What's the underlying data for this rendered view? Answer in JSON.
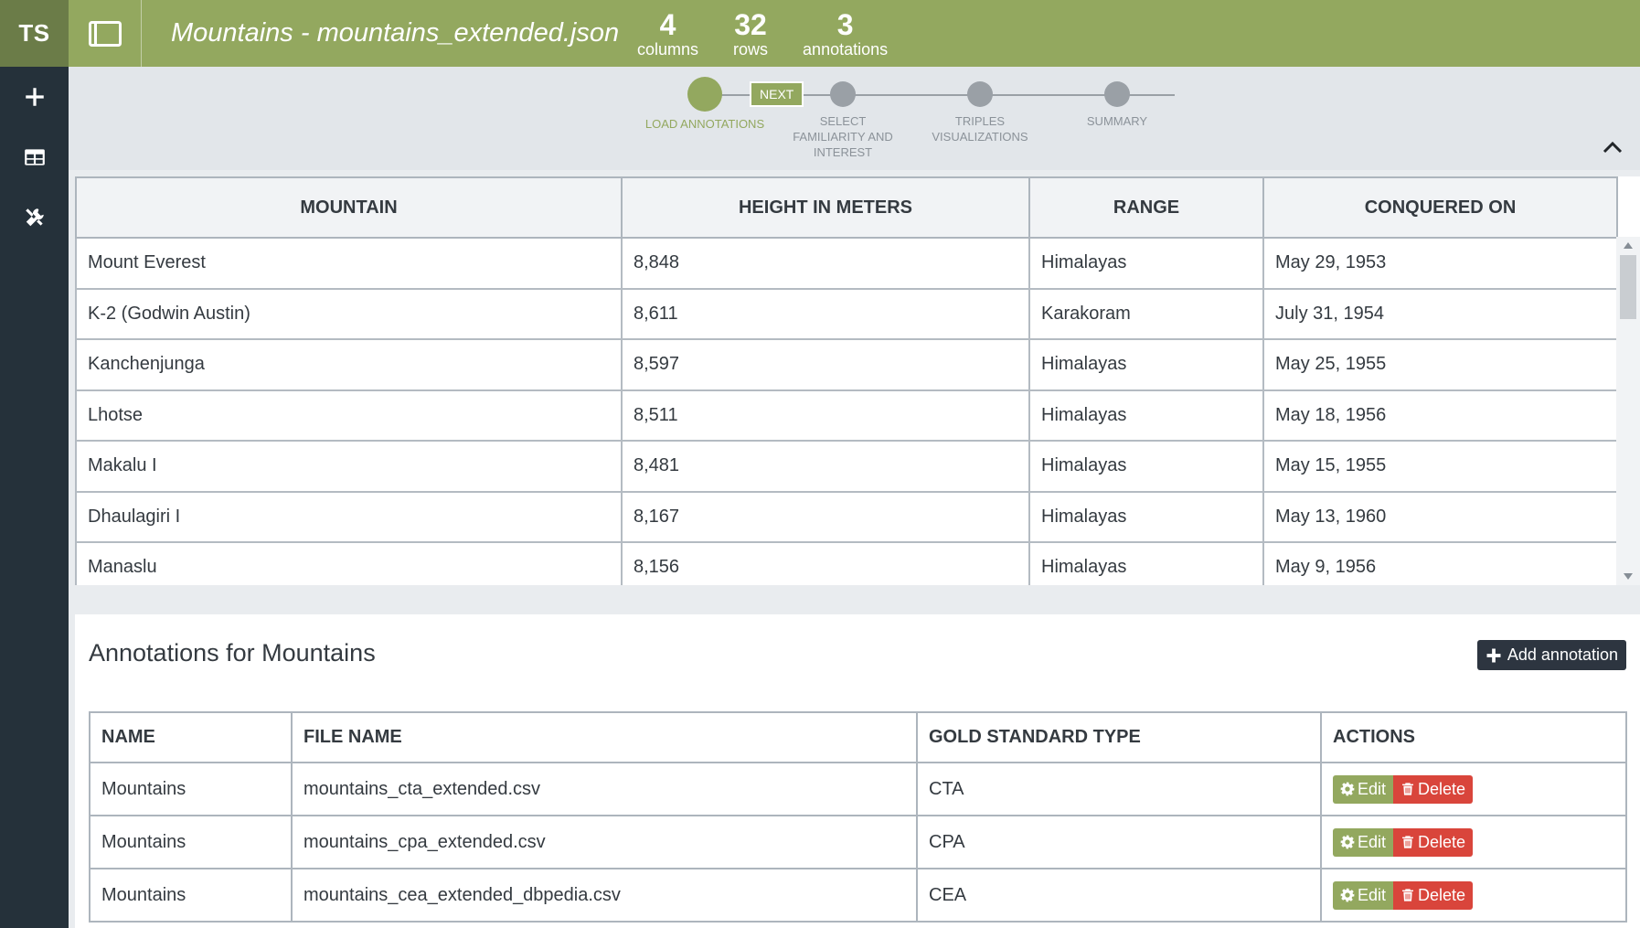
{
  "app": {
    "logo": "TS"
  },
  "header": {
    "title": "Mountains - mountains_extended.json",
    "stats": [
      {
        "value": "4",
        "label": "columns"
      },
      {
        "value": "32",
        "label": "rows"
      },
      {
        "value": "3",
        "label": "annotations"
      }
    ]
  },
  "stepper": {
    "next_label": "NEXT",
    "steps": [
      {
        "label": "LOAD ANNOTATIONS",
        "active": true
      },
      {
        "label": "SELECT FAMILIARITY AND INTEREST",
        "active": false
      },
      {
        "label": "TRIPLES VISUALIZATIONS",
        "active": false
      },
      {
        "label": "SUMMARY",
        "active": false
      }
    ]
  },
  "data_table": {
    "headers": [
      "MOUNTAIN",
      "HEIGHT IN METERS",
      "RANGE",
      "CONQUERED ON"
    ],
    "rows": [
      [
        "Mount Everest",
        "8,848",
        "Himalayas",
        "May 29, 1953"
      ],
      [
        "K-2 (Godwin Austin)",
        "8,611",
        "Karakoram",
        "July 31, 1954"
      ],
      [
        "Kanchenjunga",
        "8,597",
        "Himalayas",
        "May 25, 1955"
      ],
      [
        "Lhotse",
        "8,511",
        "Himalayas",
        "May 18, 1956"
      ],
      [
        "Makalu I",
        "8,481",
        "Himalayas",
        "May 15, 1955"
      ],
      [
        "Dhaulagiri I",
        "8,167",
        "Himalayas",
        "May 13, 1960"
      ],
      [
        "Manaslu",
        "8,156",
        "Himalayas",
        "May 9, 1956"
      ]
    ]
  },
  "annotations": {
    "title": "Annotations for Mountains",
    "add_label": "Add annotation",
    "headers": [
      "NAME",
      "FILE NAME",
      "GOLD STANDARD TYPE",
      "ACTIONS"
    ],
    "rows": [
      {
        "name": "Mountains",
        "file": "mountains_cta_extended.csv",
        "type": "CTA"
      },
      {
        "name": "Mountains",
        "file": "mountains_cpa_extended.csv",
        "type": "CPA"
      },
      {
        "name": "Mountains",
        "file": "mountains_cea_extended_dbpedia.csv",
        "type": "CEA"
      }
    ],
    "edit_label": "Edit",
    "delete_label": "Delete"
  },
  "colors": {
    "accent": "#93a85f",
    "sidebar": "#25313a",
    "danger": "#d9453b",
    "dark_button": "#2d3540"
  },
  "icons": [
    "plus-icon",
    "table-icon",
    "tools-icon",
    "sidebar-toggle-icon",
    "chevron-up-icon",
    "gear-icon",
    "trash-icon"
  ]
}
